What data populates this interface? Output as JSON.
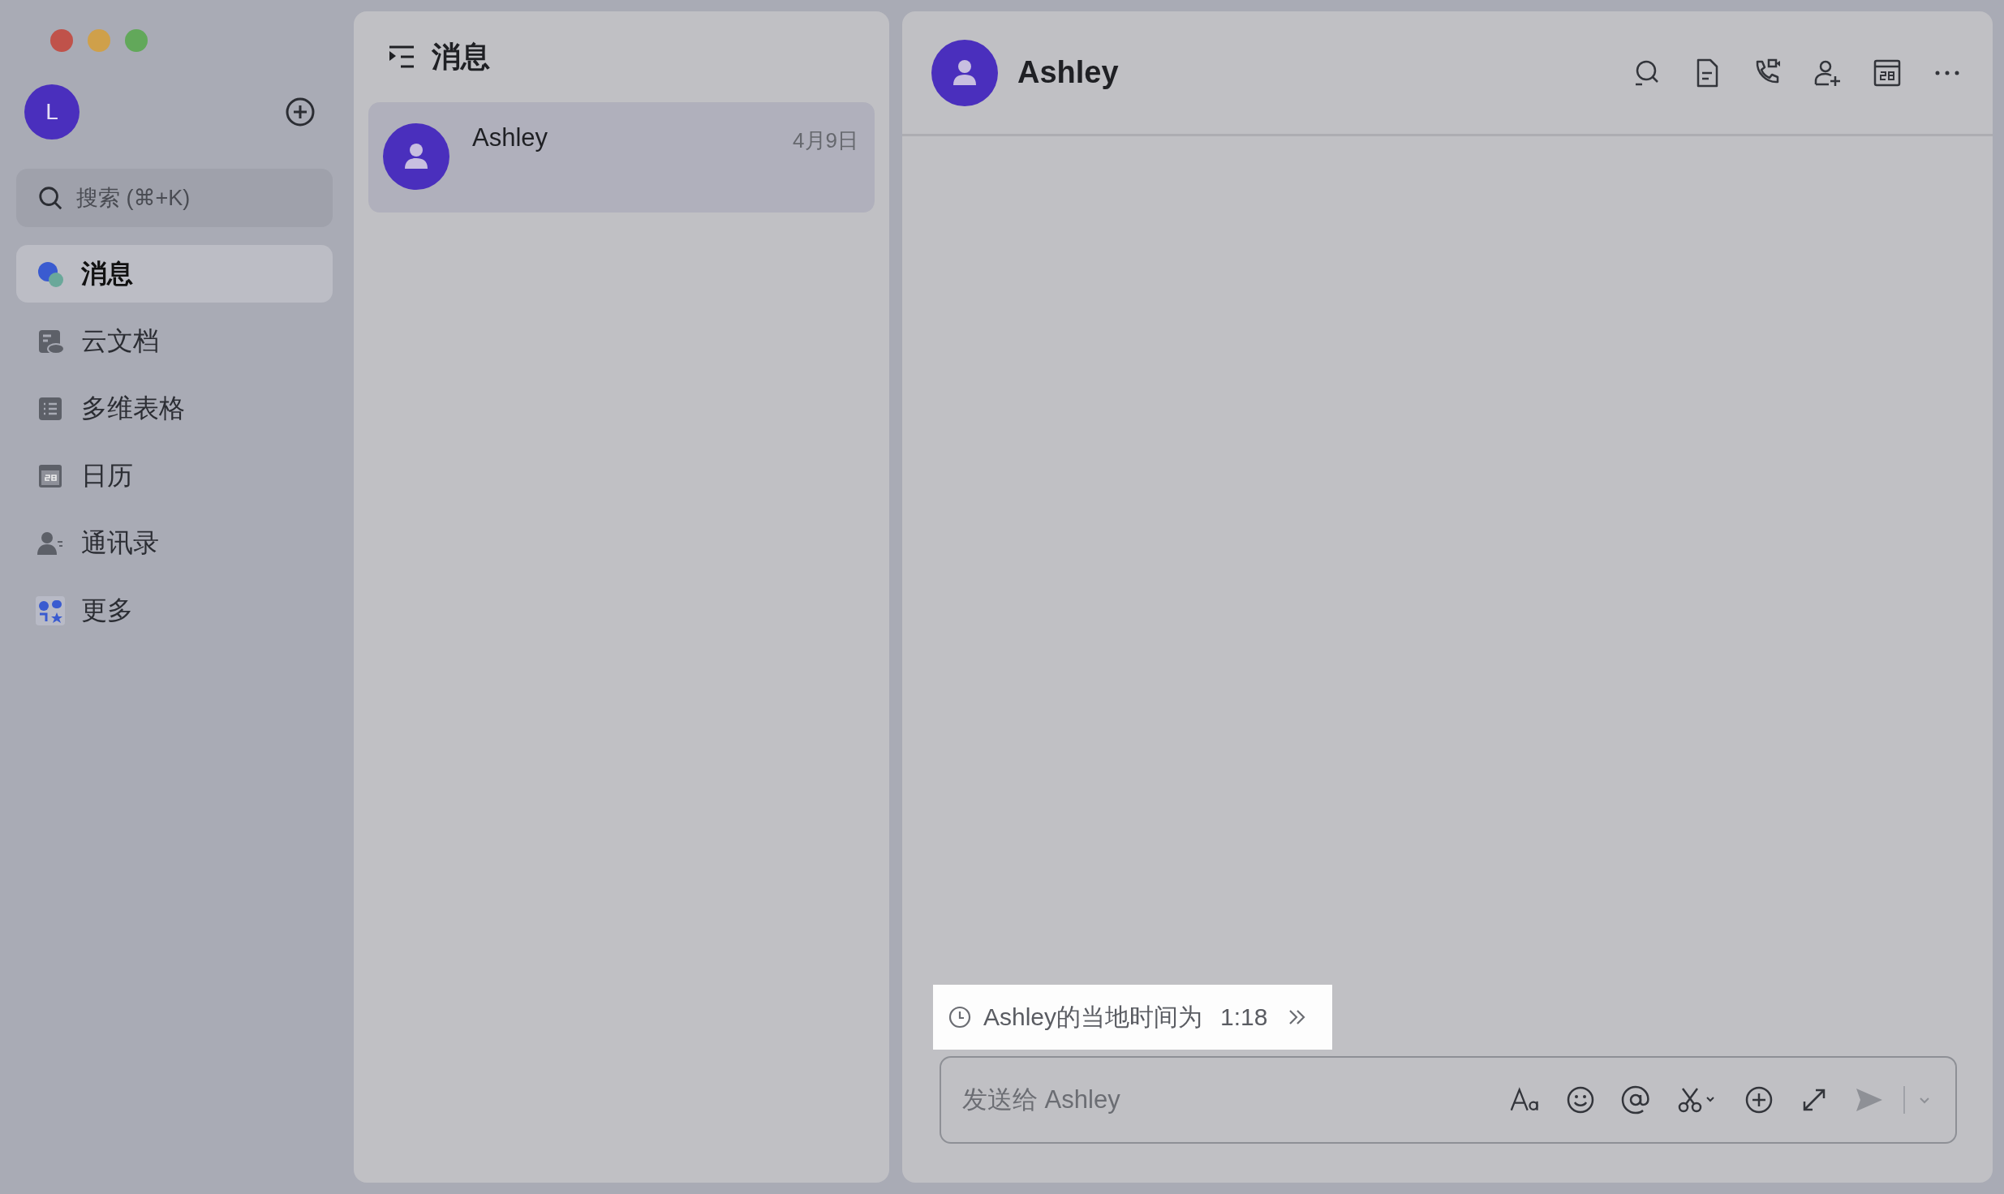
{
  "sidebar": {
    "avatar_letter": "L",
    "search": {
      "placeholder": "搜索 (⌘+K)"
    },
    "nav": [
      {
        "label": "消息",
        "selected": true
      },
      {
        "label": "云文档",
        "selected": false
      },
      {
        "label": "多维表格",
        "selected": false
      },
      {
        "label": "日历",
        "selected": false
      },
      {
        "label": "通讯录",
        "selected": false
      },
      {
        "label": "更多",
        "selected": false
      }
    ]
  },
  "conversation_list": {
    "title": "消息",
    "items": [
      {
        "name": "Ashley",
        "date": "4月9日",
        "selected": true
      }
    ]
  },
  "chat": {
    "title": "Ashley",
    "local_time": {
      "label": "Ashley的当地时间为",
      "time": "1:18"
    },
    "composer": {
      "placeholder": "发送给 Ashley"
    }
  }
}
